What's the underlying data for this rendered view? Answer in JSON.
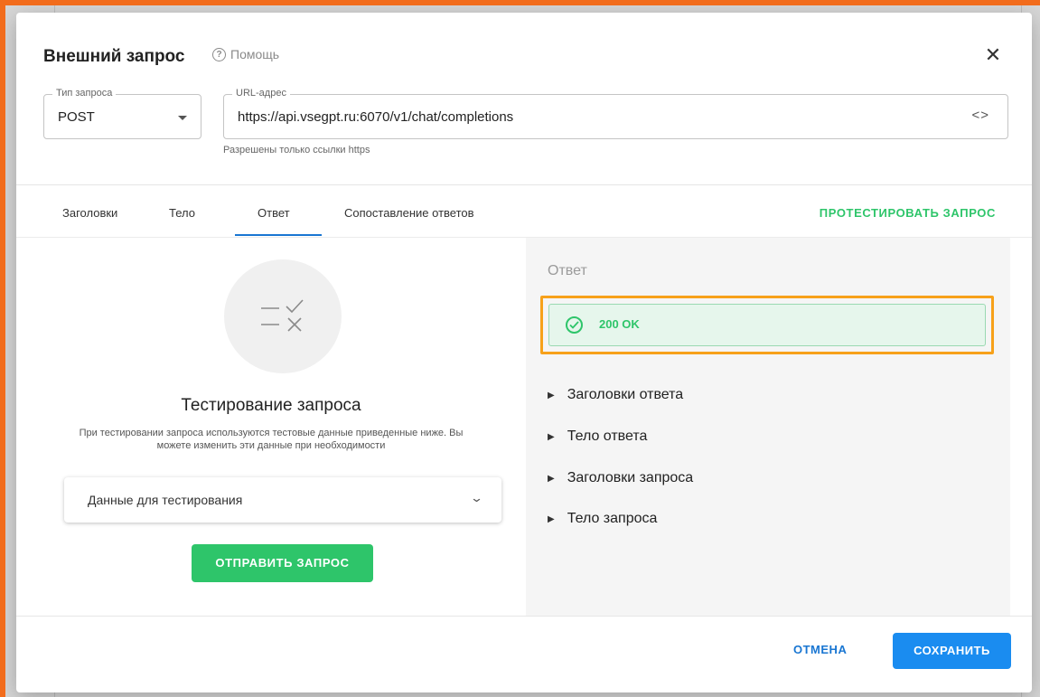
{
  "dialog": {
    "title": "Внешний запрос",
    "help_label": "Помощь",
    "close_symbol": "✕"
  },
  "request_type": {
    "label": "Тип запроса",
    "value": "POST"
  },
  "url": {
    "label": "URL-адрес",
    "value": "https://api.vsegpt.ru:6070/v1/chat/completions",
    "hint": "Разрешены только ссылки https",
    "code_symbol": "<>"
  },
  "tabs": [
    {
      "label": "Заголовки",
      "active": false
    },
    {
      "label": "Тело",
      "active": false
    },
    {
      "label": "Ответ",
      "active": true
    },
    {
      "label": "Сопоставление ответов",
      "active": false
    }
  ],
  "test_request_label": "ПРОТЕСТИРОВАТЬ ЗАПРОС",
  "left_panel": {
    "title": "Тестирование запроса",
    "description": "При тестировании запроса используются тестовые данные приведенные ниже. Вы можете изменить эти данные при необходимости",
    "test_data_label": "Данные для тестирования",
    "send_button": "ОТПРАВИТЬ ЗАПРОС"
  },
  "response": {
    "title": "Ответ",
    "status": "200 OK",
    "status_color": "#2ec56a",
    "sections": [
      "Заголовки ответа",
      "Тело ответа",
      "Заголовки запроса",
      "Тело запроса"
    ]
  },
  "footer": {
    "cancel": "ОТМЕНА",
    "save": "СОХРАНИТЬ"
  },
  "colors": {
    "accent_green": "#2ec56a",
    "accent_blue": "#1a8cf0",
    "highlight_orange": "#f7a11a",
    "frame_orange": "#f26c1c"
  }
}
